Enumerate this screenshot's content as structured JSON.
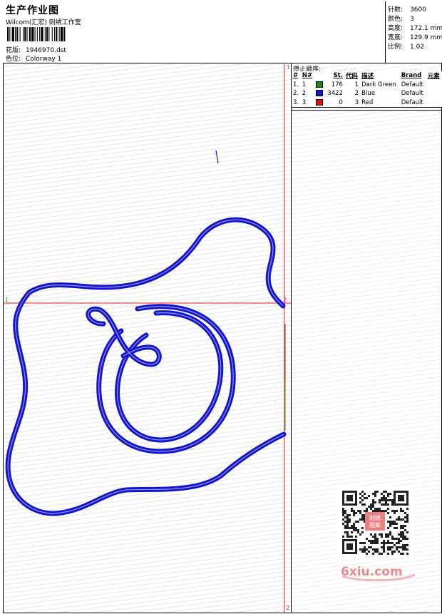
{
  "header": {
    "title": "生产作业图",
    "company": "Wilcom(汇宏) 刺绣工作室",
    "design_label": "花版:",
    "design_value": "1946970.dst",
    "colorway_label": "色位:",
    "colorway_value": "Colorway 1"
  },
  "stats": {
    "stitches_label": "针数:",
    "stitches_value": "3600",
    "colors_label": "颜色:",
    "colors_value": "3",
    "height_label": "高度:",
    "height_value": "172.1 mm",
    "width_label": "宽度:",
    "width_value": "129.9 mm",
    "scale_label": "比例:",
    "scale_value": "1.02"
  },
  "stop_sequence": {
    "heading": "停止顺序:",
    "columns": [
      "#",
      "N#",
      "St.",
      "代码",
      "描述",
      "Brand",
      "元素"
    ],
    "rows": [
      {
        "idx": "1.",
        "n": "1",
        "color": "#1a8a1a",
        "st": "176",
        "code": "1",
        "desc": "Dark Green",
        "brand": "Default"
      },
      {
        "idx": "2.",
        "n": "2",
        "color": "#1414d0",
        "st": "3422",
        "code": "2",
        "desc": "Blue",
        "brand": "Default"
      },
      {
        "idx": "3.",
        "n": "3",
        "color": "#e01010",
        "st": "0",
        "code": "3",
        "desc": "Red",
        "brand": "Default"
      }
    ]
  },
  "axes": {
    "top_marker": "1",
    "left_marker": "1",
    "right_marker": "2",
    "bottom_marker": "2"
  },
  "colors": {
    "stitch_blue": "#1414d0",
    "guide_red": "#dd2222",
    "guide_green": "#22aa22"
  },
  "watermark": {
    "text": "6xiu.com",
    "stamp_text": "刺绣图案"
  }
}
